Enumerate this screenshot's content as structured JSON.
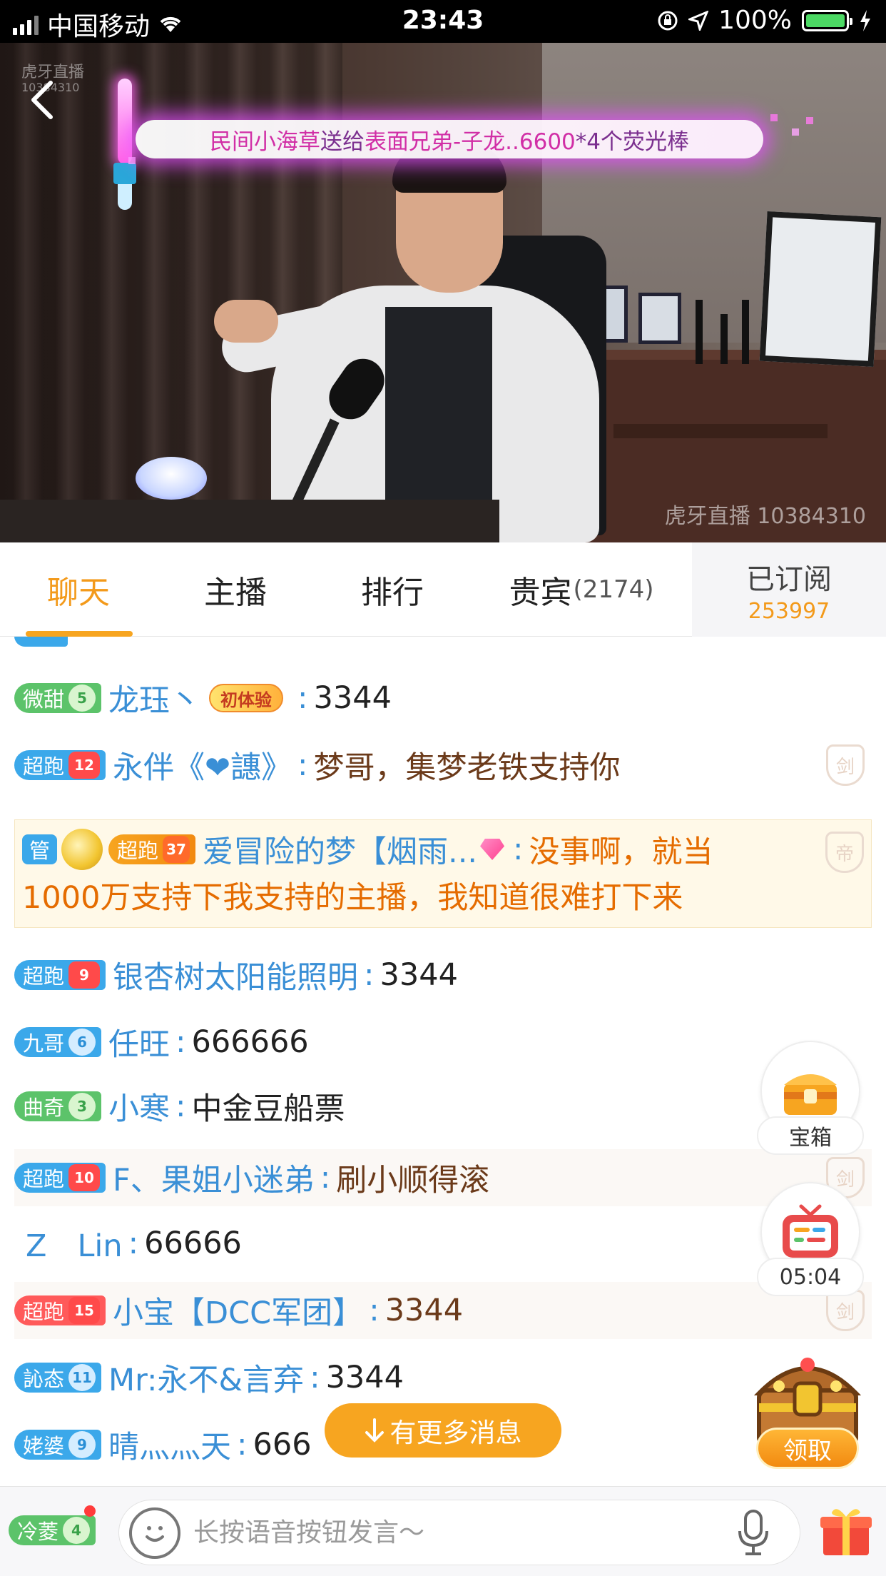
{
  "status_bar": {
    "carrier": "中国移动",
    "time": "23:43",
    "battery": "100%"
  },
  "video": {
    "watermark_top": "虎牙直播",
    "watermark_top_id": "10384310",
    "watermark_bottom": "虎牙直播 10384310",
    "gift_banner": {
      "sender": "民间小海草",
      "verb": "送给",
      "receiver": "表面兄弟-子龙..6600",
      "detail": "*4个荧光棒"
    }
  },
  "tabs": [
    {
      "label": "聊天",
      "active": true
    },
    {
      "label": "主播",
      "active": false
    },
    {
      "label": "排行",
      "active": false
    },
    {
      "label": "贵宾",
      "count": "(2174)",
      "active": false
    }
  ],
  "subscribe": {
    "label": "已订阅",
    "count": "253997"
  },
  "chat": {
    "messages": [
      {
        "badge": "微甜",
        "level": "5",
        "badge_style": "green",
        "name": "龙珏丶",
        "tag": "初体验",
        "text": "3344"
      },
      {
        "badge": "超跑",
        "level": "12",
        "badge_style": "red",
        "name": "永伴《❤譓》",
        "text": "梦哥，集梦老铁支持你",
        "shield": "剑"
      },
      {
        "manager_badge": "管",
        "badge": "超跑",
        "level": "37",
        "badge_style": "orange",
        "name": "爱冒险的梦【烟雨...",
        "text": "没事啊，就当",
        "text_line2": "1000万支持下我支持的主播，我知道很难打下来",
        "shield": "帝"
      },
      {
        "badge": "超跑",
        "level": "9",
        "badge_style": "red",
        "name": "银杏树太阳能照明",
        "text": "3344"
      },
      {
        "badge": "九哥",
        "level": "6",
        "badge_style": "blue",
        "name": "任旺",
        "text": "666666"
      },
      {
        "badge": "曲奇",
        "level": "3",
        "badge_style": "green",
        "name": "小寒",
        "text": "中金豆船票"
      },
      {
        "badge": "超跑",
        "level": "10",
        "badge_style": "red",
        "name": "F、果姐小迷弟",
        "text": "刷小顺得滚",
        "shield": "剑"
      },
      {
        "name": "Z　Lin",
        "text": "66666"
      },
      {
        "badge": "超跑",
        "level": "15",
        "badge_style": "red",
        "name": "小宝【DCC军团】",
        "text": "3344",
        "shield": "剑"
      },
      {
        "badge": "訫态",
        "level": "11",
        "badge_style": "blue",
        "name": "Mr:永不&言弃",
        "text": "3344"
      },
      {
        "badge": "姥婆",
        "level": "9",
        "badge_style": "blue",
        "name": "晴灬灬天",
        "text": "666"
      }
    ],
    "more_messages": "有更多消息"
  },
  "widgets": {
    "treasure_label": "宝箱",
    "timer_label": "05:04",
    "claim_label": "领取"
  },
  "input_bar": {
    "my_badge": "冷菱",
    "my_level": "4",
    "placeholder": "长按语音按钮发言～"
  },
  "colors": {
    "accent": "#f7a520",
    "name_blue": "#3a8fd6",
    "gift_glow": "#e650ff"
  }
}
